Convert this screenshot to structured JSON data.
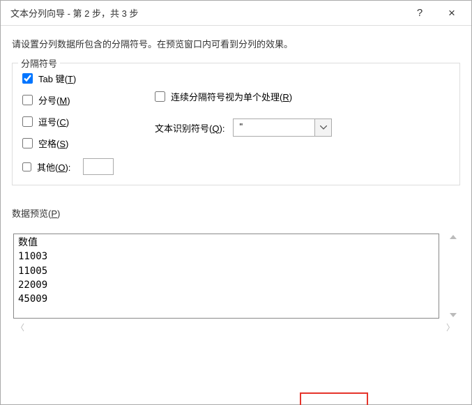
{
  "titlebar": {
    "title": "文本分列向导 - 第 2 步，共 3 步",
    "help": "?",
    "close": "×"
  },
  "instruction": "请设置分列数据所包含的分隔符号。在预览窗口内可看到分列的效果。",
  "delimiters": {
    "legend": "分隔符号",
    "tab_label_a": "Tab 键(",
    "tab_label_u": "T",
    "tab_label_b": ")",
    "semicolon_a": "分号(",
    "semicolon_u": "M",
    "semicolon_b": ")",
    "comma_a": "逗号(",
    "comma_u": "C",
    "comma_b": ")",
    "space_a": "空格(",
    "space_u": "S",
    "space_b": ")",
    "other_a": "其他(",
    "other_u": "O",
    "other_b": "):",
    "other_value": "",
    "consecutive_a": "连续分隔符号视为单个处理(",
    "consecutive_u": "R",
    "consecutive_b": ")",
    "qualifier_label_a": "文本识别符号(",
    "qualifier_label_u": "Q",
    "qualifier_label_b": ":",
    "qualifier_value": "\""
  },
  "preview": {
    "label_a": "数据预览(",
    "label_u": "P",
    "label_b": ")",
    "rows": [
      "数值",
      "11003",
      "11005",
      "22009",
      "45009"
    ]
  }
}
